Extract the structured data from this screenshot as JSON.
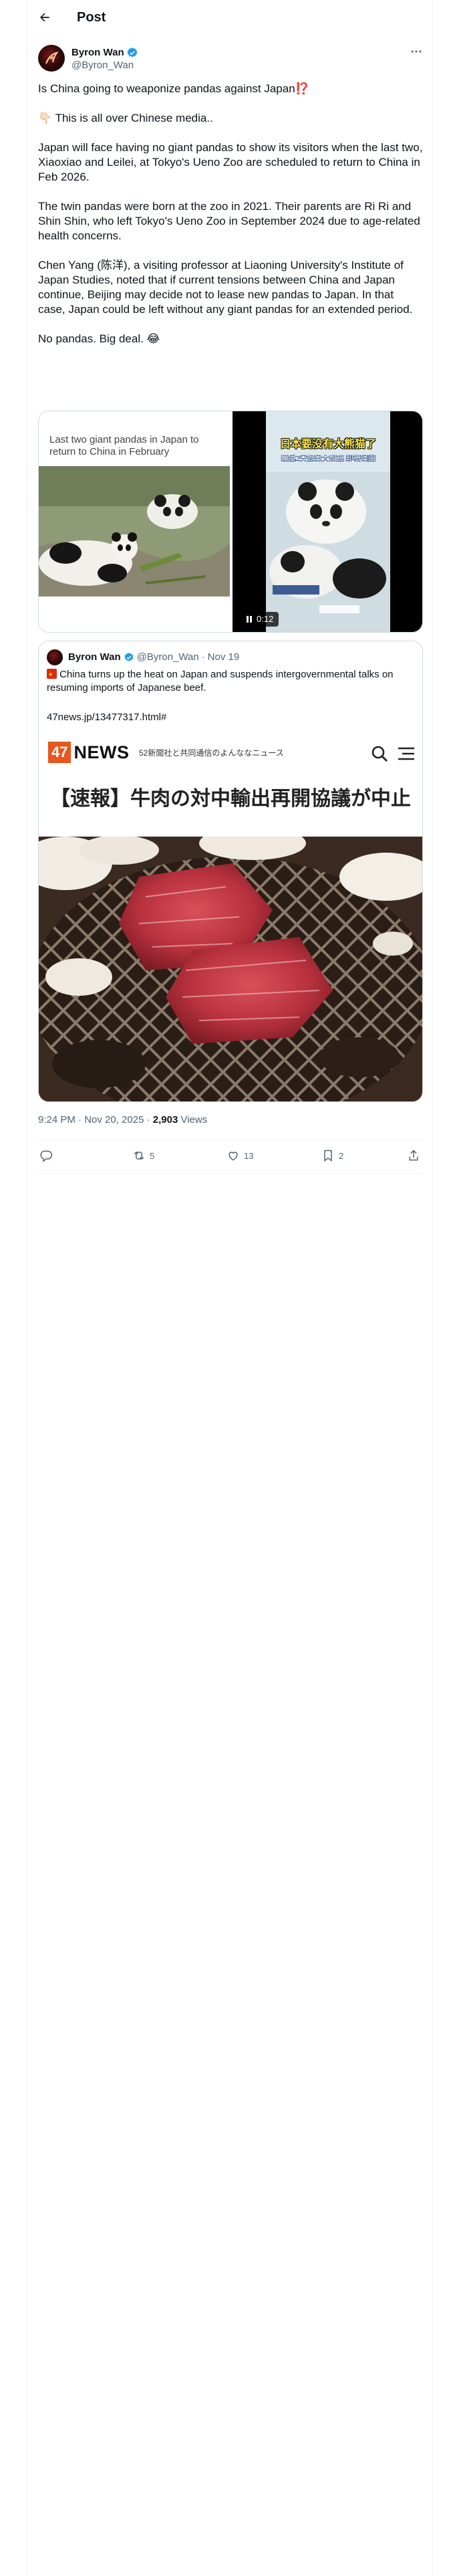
{
  "header": {
    "title": "Post"
  },
  "author": {
    "name": "Byron Wan",
    "handle": "@Byron_Wan"
  },
  "post": {
    "paragraphs": [
      "Is China going to weaponize pandas against Japan⁉️",
      "👇🏻 This is all over Chinese media..",
      "Japan will face having no giant pandas to show its visitors when the last two, Xiaoxiao and Leilei, at Tokyo's Ueno Zoo are scheduled to return to China in Feb 2026.",
      "The twin pandas were born at the zoo in 2021. Their parents are Ri Ri and Shin Shin, who left Tokyo's Ueno Zoo in September 2024 due to age-related health concerns.",
      "Chen Yang (陈洋), a visiting professor at Liaoning University's Institute of Japan Studies, noted that if current tensions between China and Japan continue, Beijing may decide not to lease new pandas to Japan. In that case, Japan could be left without any giant pandas for an extended period.",
      "No pandas. Big deal. 😂"
    ]
  },
  "media": {
    "image_caption": "Last two giant pandas in Japan to return to China in February",
    "video_banner": "日本要没有大熊猫了",
    "video_subtitle": "最后2只旅日大熊猫 即将归国",
    "video_time": "0:12"
  },
  "quote": {
    "name": "Byron Wan",
    "handle": "@Byron_Wan",
    "date": "Nov 19",
    "text": "China turns up the heat on Japan and suspends intergovernmental talks on resuming imports of Japanese beef.",
    "url": "47news.jp/13477317.html#",
    "news_logo_num": "47",
    "news_logo_text": "NEWS",
    "news_tagline": "52新聞社と共同通信のよんななニュース",
    "news_headline": "【速報】牛肉の対中輸出再開協議が中止"
  },
  "meta": {
    "time": "9:24 PM · Nov 20, 2025 · ",
    "views_count": "2,903",
    "views_label": " Views"
  },
  "actions": {
    "replies": "",
    "reposts": "5",
    "likes": "13",
    "bookmarks": "2"
  },
  "colors": {
    "verified": "#1d9bf0",
    "text": "#0f1419",
    "muted": "#536471",
    "border": "#cfd9de",
    "news_orange": "#e8561d"
  }
}
